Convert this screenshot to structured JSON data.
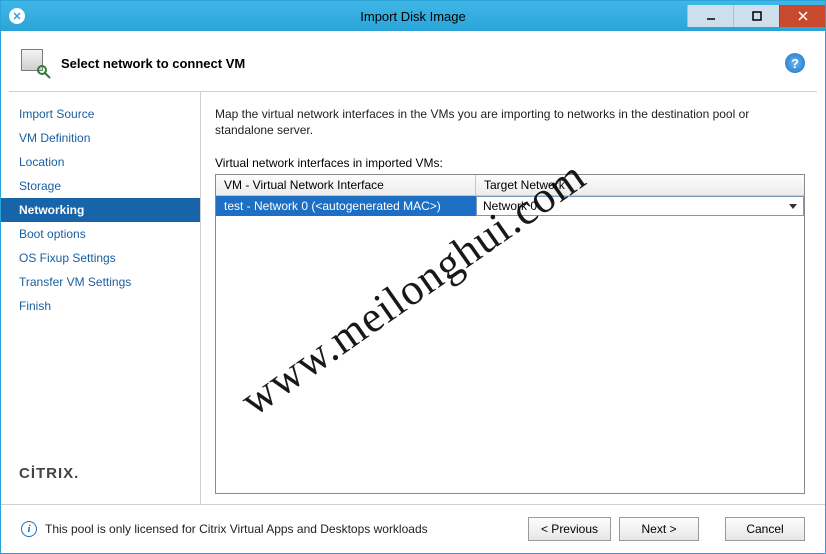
{
  "window": {
    "title": "Import Disk Image"
  },
  "header": {
    "title": "Select network to connect VM"
  },
  "sidebar": {
    "items": [
      {
        "label": "Import Source"
      },
      {
        "label": "VM Definition"
      },
      {
        "label": "Location"
      },
      {
        "label": "Storage"
      },
      {
        "label": "Networking",
        "selected": true
      },
      {
        "label": "Boot options"
      },
      {
        "label": "OS Fixup Settings"
      },
      {
        "label": "Transfer VM Settings"
      },
      {
        "label": "Finish"
      }
    ],
    "brand": "CİTRIX"
  },
  "main": {
    "description": "Map the virtual network interfaces in the VMs you are importing to networks in the destination pool or standalone server.",
    "table_label": "Virtual network interfaces in imported VMs:",
    "columns": {
      "vm_interface": "VM - Virtual Network Interface",
      "target_network": "Target Network"
    },
    "rows": [
      {
        "interface": "test - Network 0 (<autogenerated MAC>)",
        "target": "Network 0"
      }
    ]
  },
  "footer": {
    "info": "This pool is only licensed for Citrix Virtual Apps and Desktops workloads",
    "buttons": {
      "previous": "< Previous",
      "next": "Next >",
      "cancel": "Cancel"
    }
  },
  "watermark": "www.meilonghui.com"
}
